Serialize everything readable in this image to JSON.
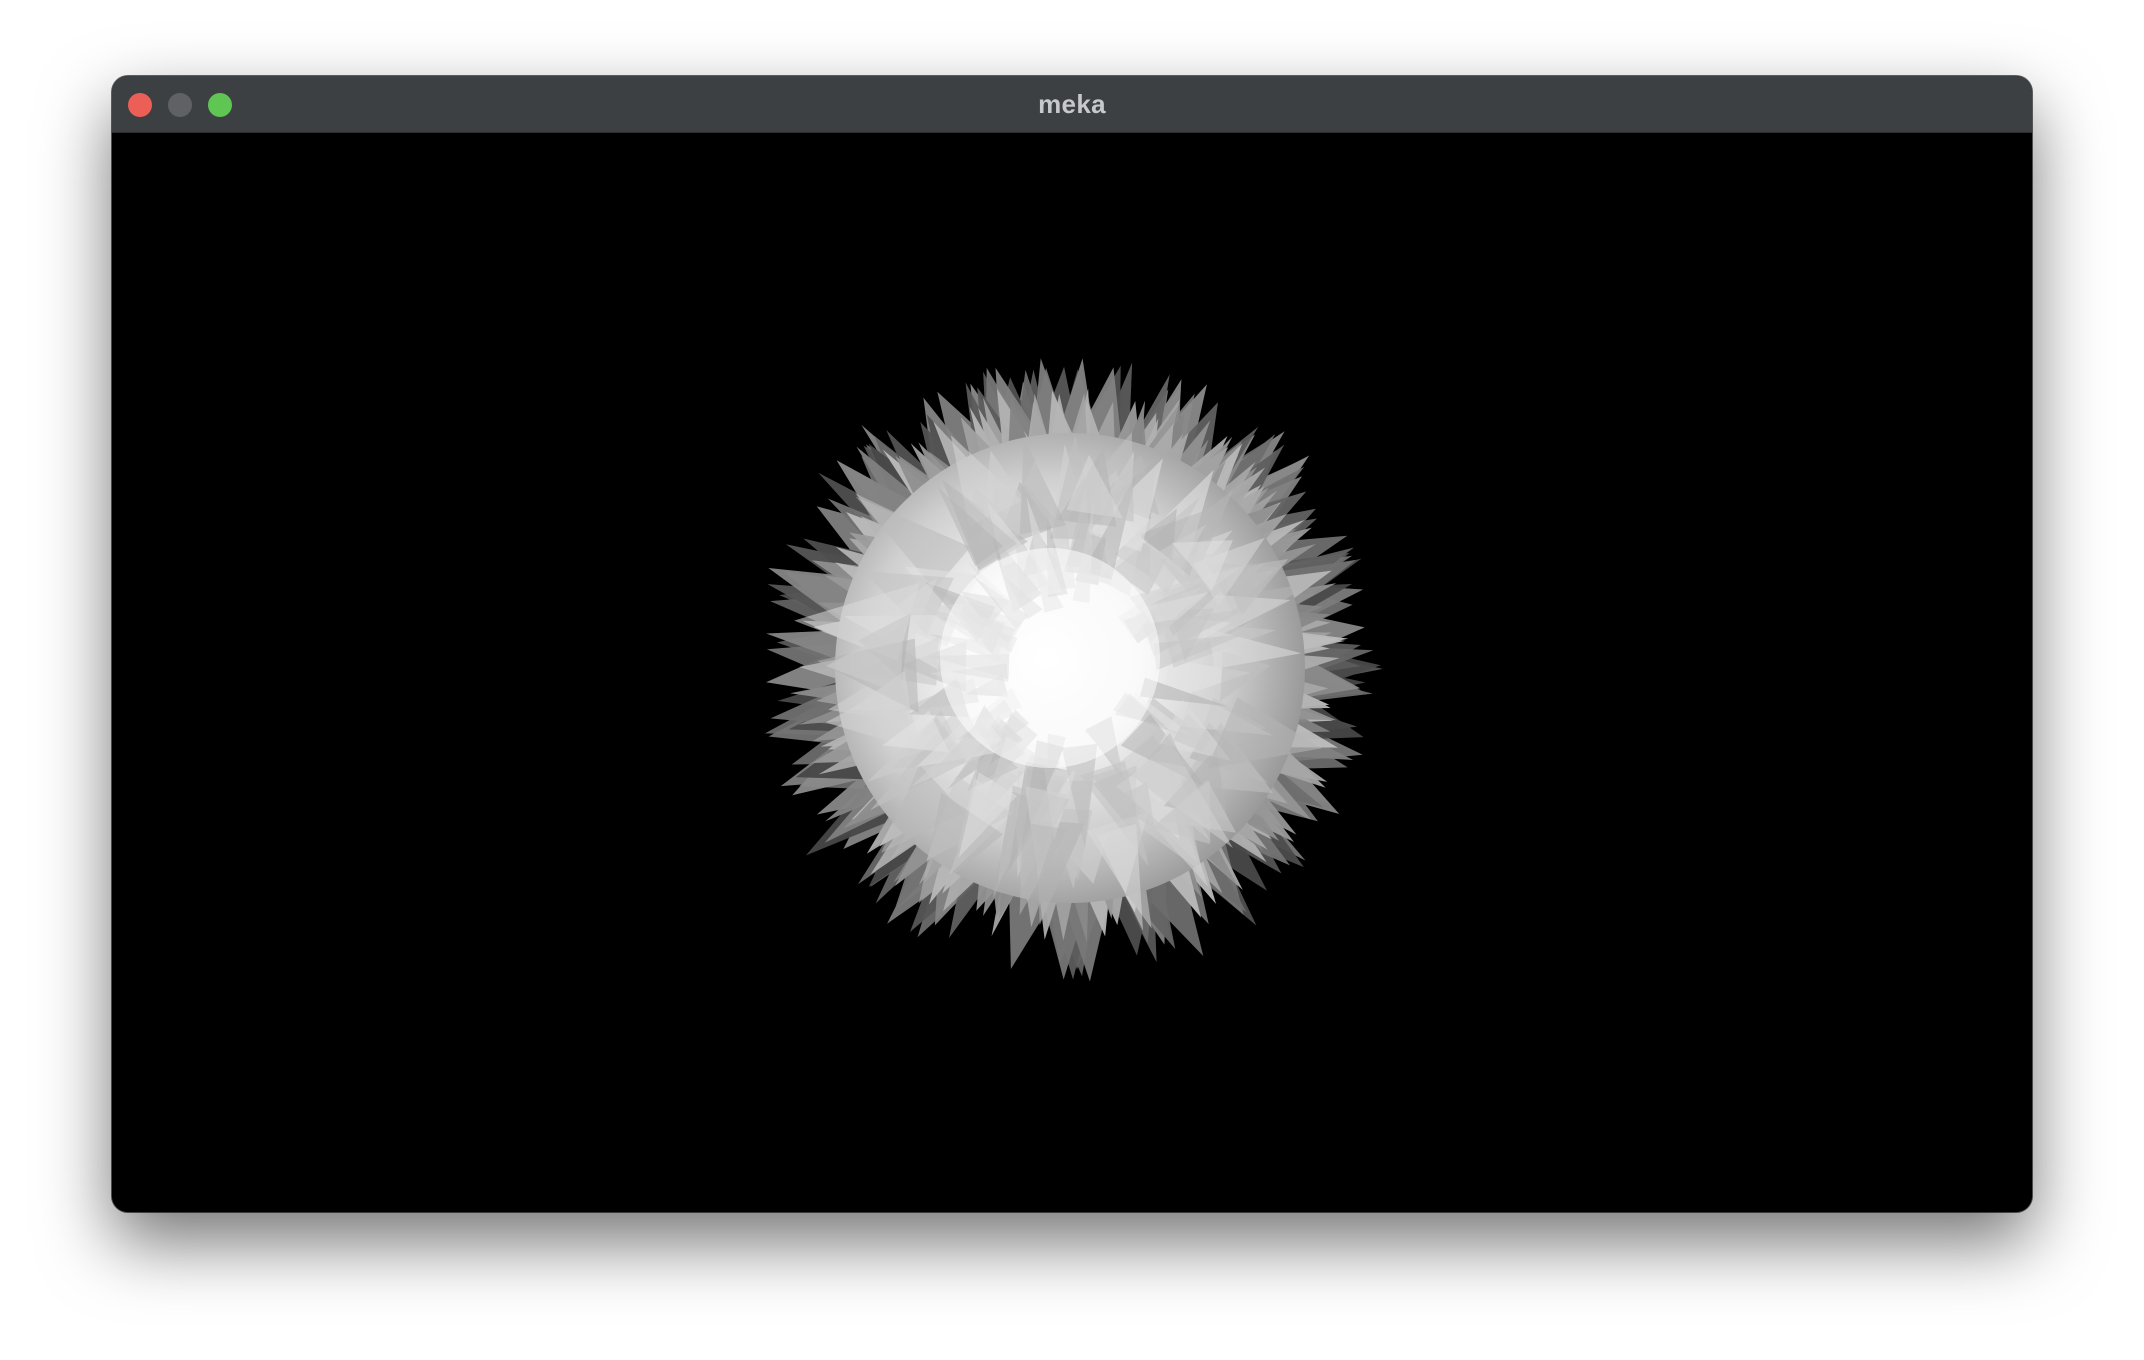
{
  "window": {
    "title": "meka",
    "controls": {
      "close_color": "#ec5f57",
      "minimize_color": "#5f6164",
      "zoom_color": "#5fc553"
    },
    "titlebar_color": "#3d4043",
    "background_color": "#000000"
  },
  "scene": {
    "object": "spiky-sphere",
    "shading": "grayscale",
    "highlight_color": "#ffffff",
    "shadow_color": "#3a3a3a"
  }
}
